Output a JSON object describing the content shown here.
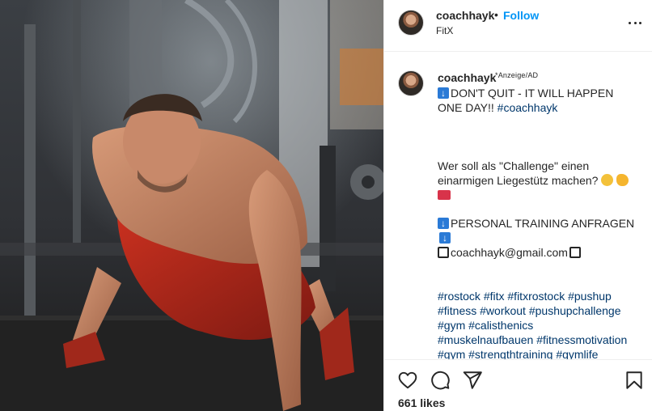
{
  "post": {
    "image_alt": "Shirtless man in red shorts performing a one-arm push-up in a gym",
    "image_colors": {
      "shorts": "#b5261c",
      "skin": "#c78a68",
      "floor": "#1e1e1e"
    }
  },
  "header": {
    "username": "coachhayk",
    "separator": "•",
    "follow_label": "Follow",
    "location": "FitX",
    "more_icon": "more-options-icon"
  },
  "caption": {
    "username": "coachhayk",
    "ad_label": "*Anzeige/AD",
    "line1_text": "DON'T QUIT - IT WILL HAPPEN ONE DAY!!",
    "line1_hashtag": "#coachhayk",
    "question": "Wer soll als \"Challenge\" einen einarmigen Liegestütz machen?",
    "training_label": "PERSONAL TRAINING ANFRAGEN",
    "email": "coachhayk@gmail.com",
    "hashtags": [
      "#rostock",
      "#fitx",
      "#fitxrostock",
      "#pushup",
      "#fitness",
      "#workout",
      "#pushupchallenge",
      "#gym",
      "#calisthenics",
      "#muskelnaufbauen",
      "#fitnessmotivation",
      "#gym",
      "#strengthtraining",
      "#gymlife"
    ]
  },
  "actions": {
    "like_icon": "heart-icon",
    "comment_icon": "comment-icon",
    "share_icon": "share-icon",
    "save_icon": "bookmark-icon",
    "likes_text": "661 likes"
  },
  "colors": {
    "link_blue": "#0095f6",
    "hashtag": "#00376b",
    "text": "#262626",
    "divider": "#efefef"
  }
}
